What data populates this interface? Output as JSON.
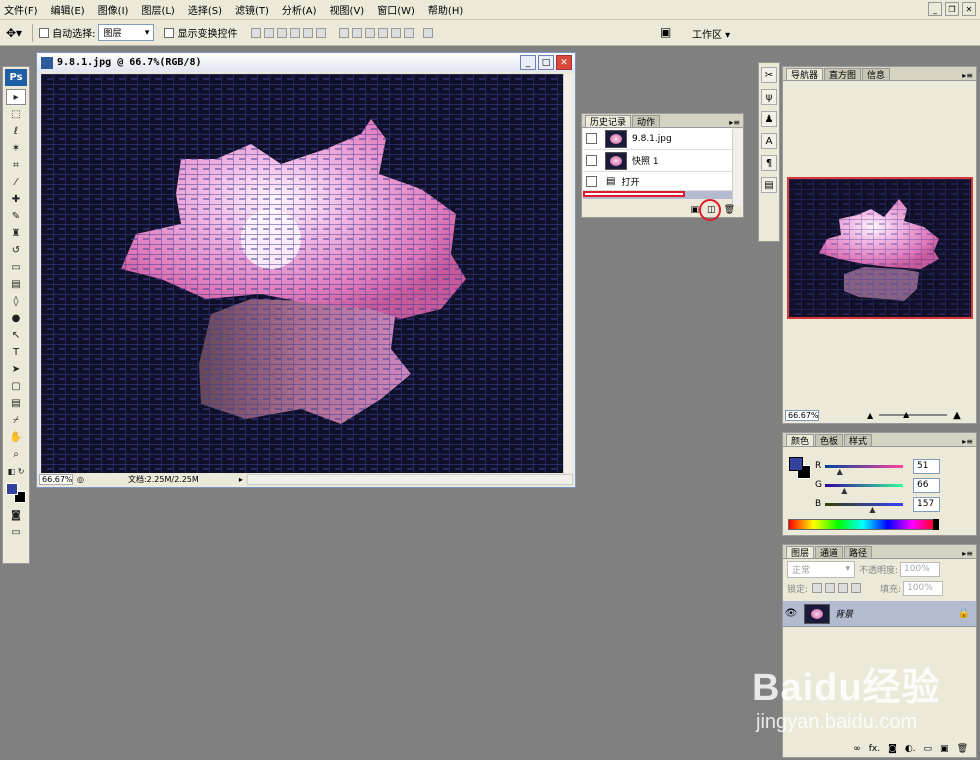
{
  "menu": [
    "文件(F)",
    "编辑(E)",
    "图像(I)",
    "图层(L)",
    "选择(S)",
    "滤镜(T)",
    "分析(A)",
    "视图(V)",
    "窗口(W)",
    "帮助(H)"
  ],
  "options": {
    "auto_select_label": "自动选择:",
    "auto_select_value": "图层",
    "show_transform_label": "显示变换控件",
    "workspace_label": "工作区 ▾"
  },
  "document": {
    "title": "9.8.1.jpg @ 66.7%(RGB/8)",
    "zoom": "66.67%",
    "doc_info": "文档:2.25M/2.25M"
  },
  "history": {
    "tabs": [
      "历史记录",
      "动作"
    ],
    "rows": [
      {
        "label": "9.8.1.jpg"
      },
      {
        "label": "快照 1"
      },
      {
        "label": "打开"
      }
    ]
  },
  "navigator": {
    "tabs": [
      "导航器",
      "直方图",
      "信息"
    ],
    "zoom": "66.67%"
  },
  "color": {
    "tabs": [
      "颜色",
      "色板",
      "样式"
    ],
    "r_label": "R",
    "g_label": "G",
    "b_label": "B",
    "r": "51",
    "g": "66",
    "b": "157",
    "r_level": 0.2,
    "g_level": 0.26,
    "b_level": 0.62,
    "foreground": "#33429d",
    "background": "#000000"
  },
  "layers": {
    "tabs": [
      "图层",
      "通道",
      "路径"
    ],
    "blend_mode": "正常",
    "opacity_label": "不透明度:",
    "opacity": "100%",
    "lock_label": "锁定:",
    "fill_label": "填充:",
    "fill": "100%",
    "layer_name": "背景"
  },
  "watermark": {
    "brand": "Baidu经验",
    "url": "jingyan.baidu.com"
  }
}
